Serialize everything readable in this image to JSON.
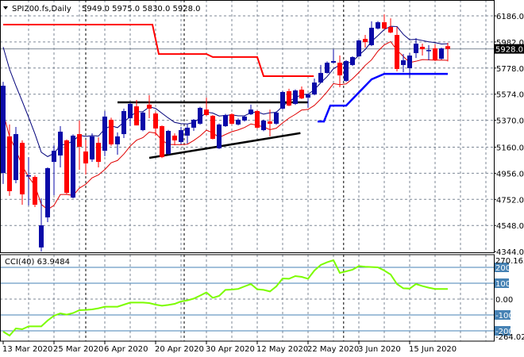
{
  "header": {
    "symbol": "SPI200.fs,Daily",
    "ohlc_text": "5949.0 5975.0 5830.0 5928.0"
  },
  "cci_panel": {
    "label": "CCI(40) 63.9484",
    "max_label": "270.1654",
    "min_label": "-264.0212"
  },
  "colors": {
    "bull": "#0a0aa8",
    "bear": "#ff0000",
    "grid": "#7d8796",
    "upper_band": "#ff0000",
    "lower_band": "#0000ff",
    "cci_line": "#7cfc00",
    "cci_levels": "#4682b4"
  },
  "chart_data": [
    {
      "type": "candlestick",
      "title": "SPI200.fs,Daily",
      "ylim": [
        4344,
        6186
      ],
      "y_ticks": [
        "6186.0",
        "5982.0",
        "5778.0",
        "5574.0",
        "5370.0",
        "5160.0",
        "4956.0",
        "4752.0",
        "4548.0",
        "4344.0"
      ],
      "current_price": "5928.0",
      "x_labels": [
        "13 Mar 2020",
        "25 Mar 2020",
        "6 Apr 2020",
        "20 Apr 2020",
        "30 Apr 2020",
        "12 May 2020",
        "22 May 2020",
        "3 Jun 2020",
        "15 Jun 2020"
      ],
      "x_label_every": 8,
      "month_separators": [
        13,
        28.5,
        53.6
      ],
      "ohlc": [
        [
          4958,
          5671,
          4872,
          5640
        ],
        [
          5244,
          5337,
          4779,
          4816
        ],
        [
          4903,
          5318,
          4878,
          5262
        ],
        [
          5194,
          5213,
          4710,
          4791
        ],
        [
          4934,
          5082,
          4704,
          4940
        ],
        [
          4927,
          4940,
          4692,
          4710
        ],
        [
          4376,
          4760,
          4344,
          4549
        ],
        [
          4611,
          5002,
          4574,
          4996
        ],
        [
          5045,
          5175,
          4785,
          5132
        ],
        [
          5095,
          5324,
          5002,
          5281
        ],
        [
          5213,
          5220,
          4795,
          4803
        ],
        [
          4766,
          5260,
          4760,
          5250
        ],
        [
          5262,
          5368,
          4983,
          5163
        ],
        [
          5126,
          5219,
          4946,
          5033
        ],
        [
          5064,
          5268,
          5045,
          5244
        ],
        [
          5194,
          5237,
          5002,
          5045
        ],
        [
          5132,
          5442,
          5089,
          5399
        ],
        [
          5374,
          5390,
          5170,
          5182
        ],
        [
          5182,
          5275,
          5101,
          5244
        ],
        [
          5262,
          5461,
          5231,
          5442
        ],
        [
          5386,
          5510,
          5324,
          5498
        ],
        [
          5479,
          5529,
          5330,
          5330
        ],
        [
          5293,
          5440,
          5285,
          5430
        ],
        [
          5492,
          5566,
          5386,
          5461
        ],
        [
          5423,
          5436,
          5250,
          5306
        ],
        [
          5324,
          5330,
          5075,
          5082
        ],
        [
          5107,
          5295,
          5100,
          5287
        ],
        [
          5250,
          5268,
          5175,
          5213
        ],
        [
          5200,
          5318,
          5182,
          5293
        ],
        [
          5250,
          5337,
          5188,
          5312
        ],
        [
          5312,
          5380,
          5287,
          5374
        ],
        [
          5343,
          5475,
          5335,
          5467
        ],
        [
          5454,
          5547,
          5405,
          5411
        ],
        [
          5405,
          5410,
          5220,
          5225
        ],
        [
          5151,
          5345,
          5145,
          5337
        ],
        [
          5324,
          5420,
          5318,
          5411
        ],
        [
          5417,
          5425,
          5335,
          5343
        ],
        [
          5337,
          5385,
          5330,
          5374
        ],
        [
          5368,
          5405,
          5360,
          5399
        ],
        [
          5417,
          5492,
          5411,
          5454
        ],
        [
          5442,
          5450,
          5305,
          5312
        ],
        [
          5293,
          5375,
          5285,
          5368
        ],
        [
          5361,
          5454,
          5244,
          5343
        ],
        [
          5343,
          5440,
          5335,
          5430
        ],
        [
          5461,
          5600,
          5455,
          5591
        ],
        [
          5597,
          5616,
          5480,
          5485
        ],
        [
          5498,
          5612,
          5490,
          5603
        ],
        [
          5609,
          5634,
          5535,
          5541
        ],
        [
          5547,
          5580,
          5467,
          5572
        ],
        [
          5572,
          5696,
          5565,
          5665
        ],
        [
          5665,
          5802,
          5660,
          5740
        ],
        [
          5740,
          5830,
          5735,
          5820
        ],
        [
          5820,
          5926,
          5815,
          5833
        ],
        [
          5820,
          5876,
          5628,
          5721
        ],
        [
          5678,
          5840,
          5670,
          5833
        ],
        [
          5802,
          5870,
          5795,
          5864
        ],
        [
          5870,
          6000,
          5865,
          5994
        ],
        [
          6006,
          6037,
          5938,
          5981
        ],
        [
          5957,
          6143,
          5950,
          6093
        ],
        [
          6087,
          6145,
          6080,
          6136
        ],
        [
          6136,
          6198,
          6080,
          6087
        ],
        [
          6099,
          6167,
          6050,
          6056
        ],
        [
          6037,
          6099,
          5752,
          5771
        ],
        [
          5802,
          5888,
          5746,
          5839
        ],
        [
          5777,
          5895,
          5702,
          5876
        ],
        [
          5895,
          6012,
          5857,
          5969
        ],
        [
          5944,
          5969,
          5876,
          5926
        ],
        [
          5913,
          5957,
          5839,
          5919
        ],
        [
          5932,
          5963,
          5833,
          5839
        ],
        [
          5851,
          5938,
          5845,
          5932
        ],
        [
          5949,
          5975,
          5830,
          5928
        ]
      ],
      "upper_band": [
        [
          0,
          6118
        ],
        [
          23.5,
          6118
        ],
        [
          24.5,
          5888
        ],
        [
          32,
          5888
        ],
        [
          33,
          5864
        ],
        [
          40,
          5864
        ],
        [
          41,
          5715
        ],
        [
          48.9,
          5715
        ]
      ],
      "lower_band": [
        [
          49.5,
          5361
        ],
        [
          50.5,
          5361
        ],
        [
          51.5,
          5485
        ],
        [
          54,
          5485
        ],
        [
          58,
          5690
        ],
        [
          60,
          5733
        ],
        [
          70,
          5733
        ]
      ],
      "trend_lines": [
        {
          "name": "resistance",
          "points": [
            [
              18,
              5510
            ],
            [
              48,
              5510
            ]
          ]
        },
        {
          "name": "support",
          "points": [
            [
              23,
              5076
            ],
            [
              46.8,
              5270
            ]
          ]
        }
      ],
      "ma_fast": {
        "series": "high",
        "period": 6,
        "seed": 6050
      },
      "ma_slow": {
        "series": "low",
        "period": 6,
        "seed": 5650
      }
    },
    {
      "type": "line",
      "title": "CCI(40)",
      "ylim": [
        -264.0212,
        270.1654
      ],
      "levels": [
        "200",
        "100",
        "0.00",
        "-100",
        "-200"
      ],
      "level_values": [
        200,
        100,
        0,
        -100,
        -200
      ],
      "values": [
        -205,
        -230,
        -185,
        -190,
        -172,
        -172,
        -172,
        -135,
        -105,
        -90,
        -98,
        -88,
        -70,
        -68,
        -65,
        -58,
        -48,
        -48,
        -48,
        -35,
        -22,
        -22,
        -22,
        -25,
        -35,
        -42,
        -37,
        -30,
        -15,
        -8,
        3,
        22,
        42,
        8,
        20,
        58,
        60,
        64,
        80,
        95,
        62,
        58,
        48,
        80,
        130,
        128,
        145,
        140,
        128,
        180,
        215,
        232,
        245,
        165,
        175,
        185,
        208,
        204,
        202,
        200,
        180,
        155,
        95,
        68,
        66,
        95,
        82,
        72,
        64,
        64,
        63.9484
      ]
    }
  ]
}
